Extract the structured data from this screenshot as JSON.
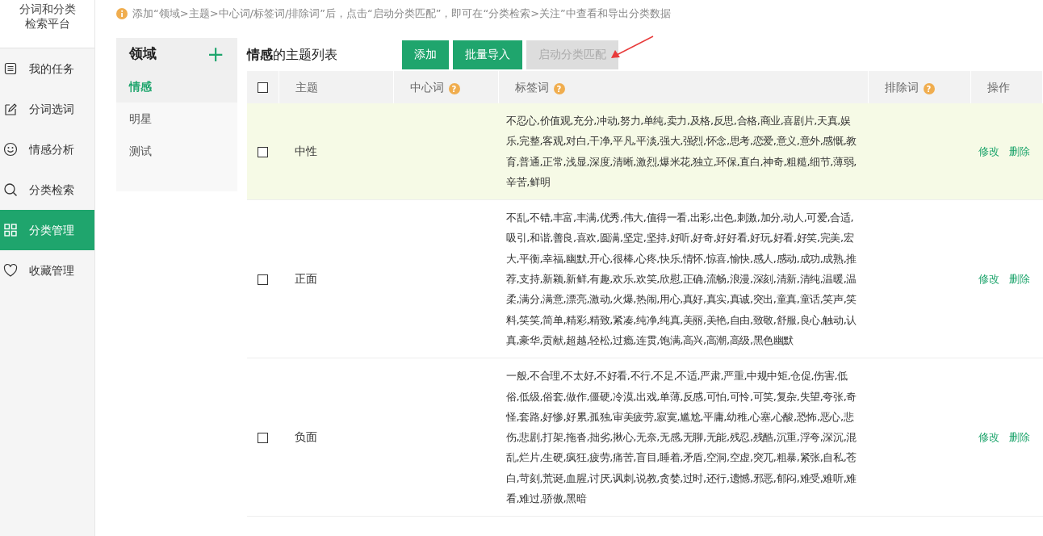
{
  "app_title": "分词和分类检索平台",
  "sidebar": {
    "items": [
      {
        "label": "我的任务",
        "selected": false
      },
      {
        "label": "分词选词",
        "selected": false
      },
      {
        "label": "情感分析",
        "selected": false
      },
      {
        "label": "分类检索",
        "selected": false
      },
      {
        "label": "分类管理",
        "selected": true
      },
      {
        "label": "收藏管理",
        "selected": false
      }
    ]
  },
  "notice": "添加“领域>主题>中心词/标签词/排除词”后，点击“启动分类匹配”，即可在“分类检索>关注”中查看和导出分类数据",
  "domain_panel": {
    "title": "领域",
    "add": "+",
    "items": [
      {
        "label": "情感",
        "selected": true
      },
      {
        "label": "明星",
        "selected": false
      },
      {
        "label": "测试",
        "selected": false
      }
    ]
  },
  "topic_panel": {
    "title": "**情感**的主题列表",
    "buttons": [
      {
        "label": "添加",
        "disabled": false
      },
      {
        "label": "批量导入",
        "disabled": false
      },
      {
        "label": "启动分类匹配",
        "disabled": true
      }
    ],
    "table": {
      "columns": [
        {
          "label": "主题"
        },
        {
          "label": "中心词",
          "help": "?"
        },
        {
          "label": "标签词",
          "help": "?"
        },
        {
          "label": "排除词",
          "help": "?"
        },
        {
          "label": "操作"
        }
      ],
      "header_checked": false,
      "rows": [
        {
          "checked": false,
          "highlighted": true,
          "topic": "中性",
          "tags": "不忍心,价值观,充分,冲动,努力,单纯,卖力,及格,反思,合格,商业,喜剧片,天真,娱乐,完整,客观,对白,干净,平凡,平淡,强大,强烈,怀念,思考,恋爱,意义,意外,感慨,教育,普通,正常,浅显,深度,清晰,激烈,爆米花,独立,环保,直白,神奇,粗糙,细节,薄弱,辛苦,鲜明",
          "actions": [
            "修改",
            "删除"
          ]
        },
        {
          "checked": false,
          "highlighted": false,
          "topic": "正面",
          "tags": "不乱,不错,丰富,丰满,优秀,伟大,值得一看,出彩,出色,刺激,加分,动人,可爱,合适,吸引,和谐,善良,喜欢,圆满,坚定,坚持,好听,好奇,好好看,好玩,好看,好笑,完美,宏大,平衡,幸福,幽默,开心,很棒,心疼,快乐,情怀,惊喜,愉快,感人,感动,成功,成熟,推荐,支持,新颖,新鲜,有趣,欢乐,欢笑,欣慰,正确,流畅,浪漫,深刻,清新,清纯,温暖,温柔,满分,满意,漂亮,激动,火爆,热闹,用心,真好,真实,真诚,突出,童真,童话,笑声,笑料,笑笑,简单,精彩,精致,紧凑,纯净,纯真,美丽,美艳,自由,致敬,舒服,良心,触动,认真,豪华,贡献,超越,轻松,过瘾,连贯,饱满,高兴,高潮,高级,黑色幽默",
          "actions": [
            "修改",
            "删除"
          ]
        },
        {
          "checked": false,
          "highlighted": false,
          "topic": "负面",
          "tags": "一般,不合理,不太好,不好看,不行,不足,不适,严肃,严重,中规中矩,仓促,伤害,低俗,低级,俗套,做作,僵硬,冷漠,出戏,单薄,反感,可怕,可怜,可笑,复杂,失望,夸张,奇怪,套路,好惨,好累,孤独,审美疲劳,寂寞,尴尬,平庸,幼稚,心塞,心酸,恐怖,恶心,悲伤,悲剧,打架,拖沓,拙劣,揪心,无奈,无感,无聊,无能,残忍,残酷,沉重,浮夸,深沉,混乱,烂片,生硬,疯狂,疲劳,痛苦,盲目,睡着,矛盾,空洞,空虚,突兀,粗暴,紧张,自私,苍白,苛刻,荒诞,血腥,讨厌,讽刺,说教,贪婪,过时,还行,遗憾,邪恶,郁闷,难受,难听,难看,难过,骄傲,黑暗",
          "actions": [
            "修改",
            "删除"
          ]
        }
      ]
    }
  }
}
